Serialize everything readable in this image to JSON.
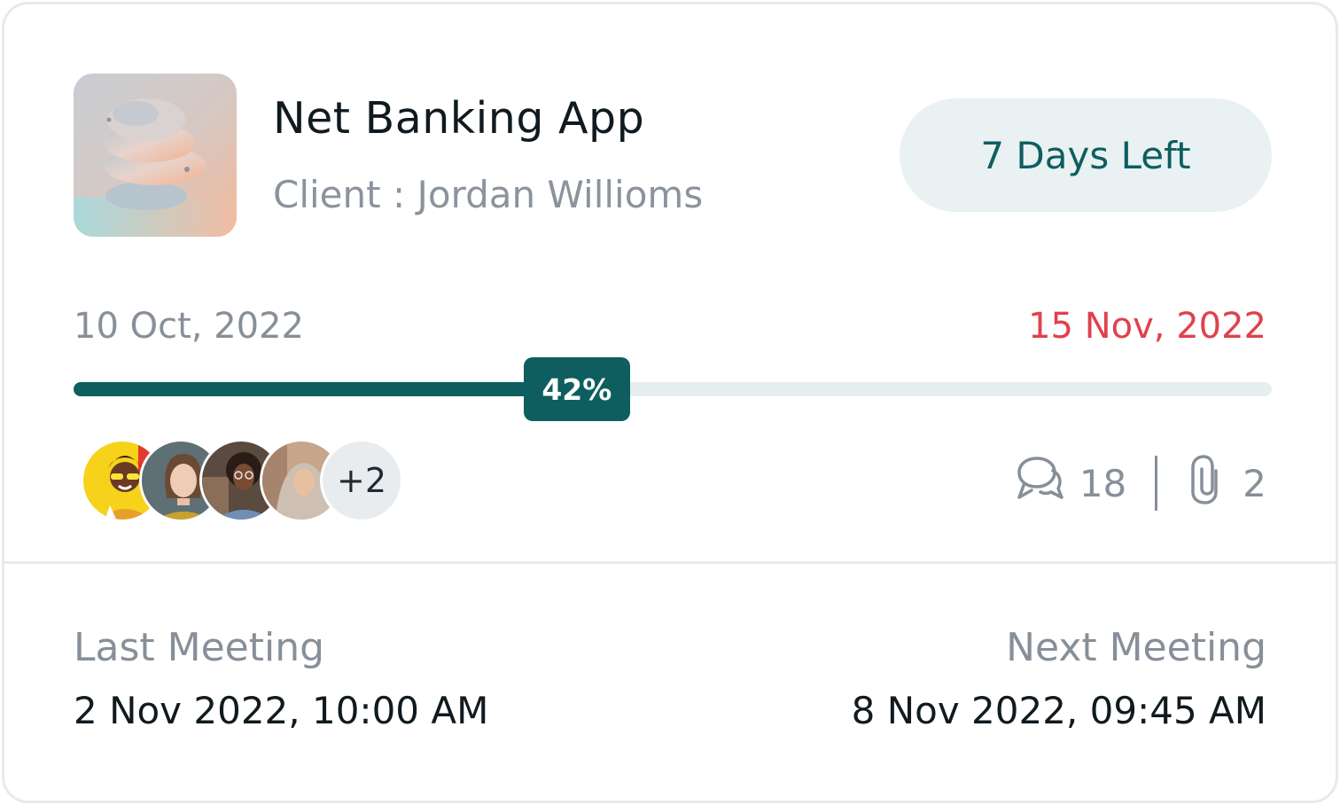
{
  "project": {
    "title": "Net Banking App",
    "client_label": "Client :",
    "client_name": "Jordan Willioms",
    "days_left": "7 Days Left"
  },
  "timeline": {
    "start_date": "10 Oct, 2022",
    "end_date": "15 Nov, 2022",
    "progress": 42,
    "progress_label": "42%"
  },
  "team": {
    "extra_count": "+2"
  },
  "stats": {
    "comments_icon": "chat-bubbles-icon",
    "comments": "18",
    "attachments_icon": "paperclip-icon",
    "attachments": "2"
  },
  "meetings": {
    "last_label": "Last Meeting",
    "last_value": "2 Nov 2022, 10:00 AM",
    "next_label": "Next Meeting",
    "next_value": "8 Nov 2022, 09:45 AM"
  },
  "colors": {
    "accent": "#0e5e5f",
    "deadline": "#e0414d",
    "muted": "#878f99",
    "pill_bg": "#e9f1f2"
  }
}
